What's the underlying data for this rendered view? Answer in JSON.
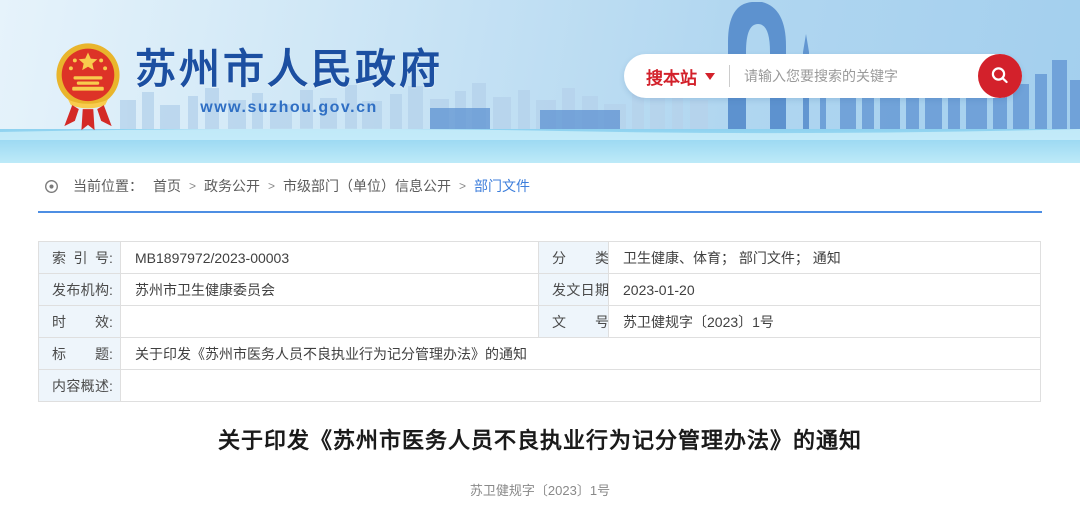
{
  "header": {
    "site_name": "苏州市人民政府",
    "site_url": "www.suzhou.gov.cn",
    "search": {
      "scope_label": "搜本站",
      "placeholder": "请输入您要搜索的关键字"
    }
  },
  "breadcrumb": {
    "prefix": "当前位置：",
    "separator": ">",
    "items": [
      {
        "label": "首页"
      },
      {
        "label": "政务公开"
      },
      {
        "label": "市级部门（单位）信息公开"
      },
      {
        "label": "部门文件"
      }
    ]
  },
  "meta_table": {
    "colon": ":",
    "rows2col": [
      {
        "label1": "索引号",
        "value1": "MB1897972/2023-00003",
        "label2": "分类",
        "value2": "卫生健康、体育； 部门文件； 通知"
      },
      {
        "label1": "发布机构",
        "value1": "苏州市卫生健康委员会",
        "label2": "发文日期",
        "value2": "2023-01-20"
      },
      {
        "label1": "时效",
        "value1": "",
        "label2": "文号",
        "value2": "苏卫健规字〔2023〕1号"
      }
    ],
    "rows1col": [
      {
        "label": "标题",
        "value": "关于印发《苏州市医务人员不良执业行为记分管理办法》的通知"
      },
      {
        "label": "内容概述",
        "value": ""
      }
    ]
  },
  "article": {
    "title": "关于印发《苏州市医务人员不良执业行为记分管理办法》的通知",
    "doc_number": "苏卫健规字〔2023〕1号"
  },
  "colors": {
    "brand_blue": "#1c4fa1",
    "accent_red": "#d3212b",
    "divider_blue": "#4d8ee3",
    "link_blue": "#3d7edb",
    "table_label_bg": "#eef5fb"
  }
}
